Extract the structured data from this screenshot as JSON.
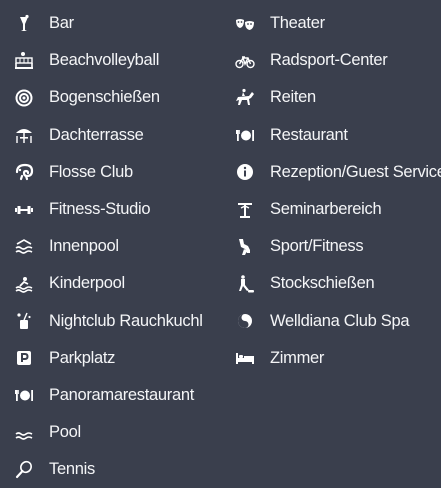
{
  "columns": {
    "left": [
      {
        "label": "Bar",
        "icon": "cocktail-icon"
      },
      {
        "label": "Beachvolleyball",
        "icon": "beach-volleyball-icon"
      },
      {
        "label": "Bogenschießen",
        "icon": "target-icon"
      },
      {
        "label": "Dachterrasse",
        "icon": "terrace-umbrella-icon"
      },
      {
        "label": "Flosse Club",
        "icon": "chameleon-icon"
      },
      {
        "label": "Fitness-Studio",
        "icon": "dumbbell-icon"
      },
      {
        "label": "Innenpool",
        "icon": "indoor-pool-icon"
      },
      {
        "label": "Kinderpool",
        "icon": "kids-pool-icon"
      },
      {
        "label": "Nightclub Rauchkuchl",
        "icon": "nightclub-drink-icon"
      },
      {
        "label": "Parkplatz",
        "icon": "parking-icon"
      },
      {
        "label": "Panoramarestaurant",
        "icon": "cutlery-plate-icon"
      },
      {
        "label": "Pool",
        "icon": "pool-waves-icon"
      },
      {
        "label": "Tennis",
        "icon": "tennis-racket-icon"
      }
    ],
    "right": [
      {
        "label": "Theater",
        "icon": "theater-masks-icon"
      },
      {
        "label": "Radsport-Center",
        "icon": "bicycle-icon"
      },
      {
        "label": "Reiten",
        "icon": "horse-rider-icon"
      },
      {
        "label": "Restaurant",
        "icon": "cutlery-plate-icon"
      },
      {
        "label": "Rezeption/Guest Service",
        "icon": "info-icon"
      },
      {
        "label": "Seminarbereich",
        "icon": "lectern-icon"
      },
      {
        "label": "Sport/Fitness",
        "icon": "running-shoe-icon"
      },
      {
        "label": "Stockschießen",
        "icon": "curling-player-icon"
      },
      {
        "label": "Welldiana Club Spa",
        "icon": "spa-icon"
      },
      {
        "label": "Zimmer",
        "icon": "bed-icon"
      }
    ]
  },
  "colors": {
    "background": "#3a3f4d",
    "text": "#f4f5f7",
    "icon": "#ffffff"
  }
}
